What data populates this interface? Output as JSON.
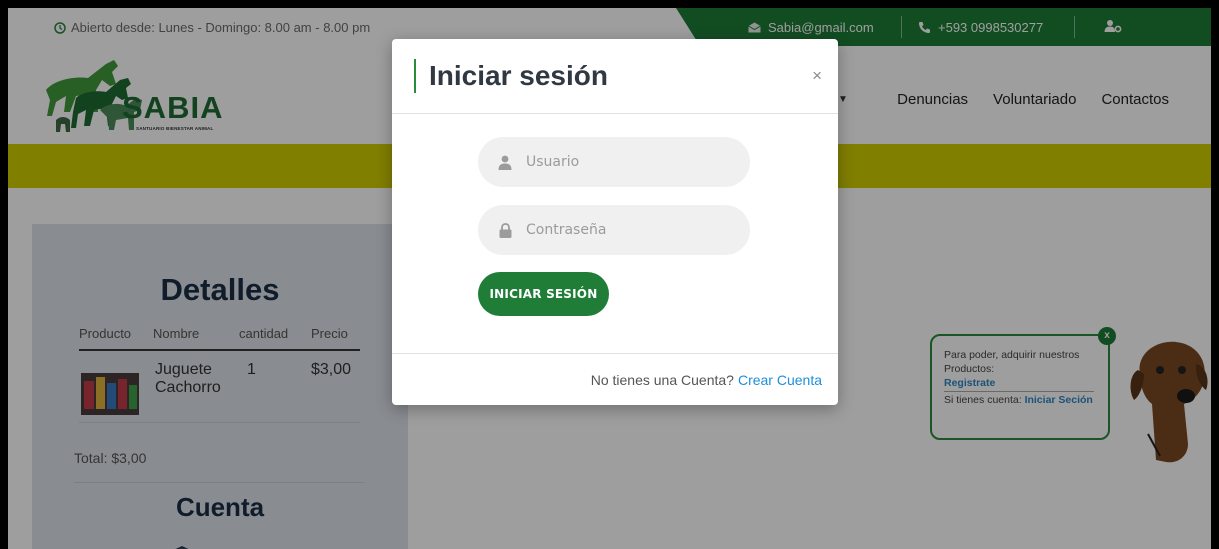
{
  "topbar": {
    "hours": "Abierto desde: Lunes - Domingo: 8.00 am - 8.00 pm",
    "email": "Sabia@gmail.com",
    "phone": "+593 0998530277",
    "icons": [
      "clock-icon",
      "envelope-icon",
      "phone-icon",
      "user-cog-icon"
    ]
  },
  "brand": {
    "name": "SABIA",
    "tagline": "SANTUARIO BIENESTAR ANIMAL"
  },
  "nav": {
    "items": [
      "Denuncias",
      "Voluntariado",
      "Contactos"
    ]
  },
  "colors": {
    "primary_green": "#1e7d38",
    "yellow_band": "#d1cd00",
    "link_blue": "#1e8fd8"
  },
  "details": {
    "title": "Detalles",
    "columns": [
      "Producto",
      "Nombre",
      "cantidad",
      "Precio"
    ],
    "rows": [
      {
        "name": "Juguete Cachorro",
        "qty": "1",
        "price": "$3,00"
      }
    ],
    "total": "Total: $3,00",
    "account_title": "Cuenta"
  },
  "tooltip": {
    "close": "x",
    "line1": "Para poder, adquirir nuestros Productos:",
    "register": "Registrate",
    "line2": "Si tienes cuenta:",
    "login": "Iniciar Seción"
  },
  "modal": {
    "title": "Iniciar sesión",
    "close": "×",
    "username_placeholder": "Usuario",
    "password_placeholder": "Contraseña",
    "submit": "INICIAR SESIÓN",
    "footer_text": "No tienes una Cuenta?",
    "footer_link": "Crear Cuenta"
  }
}
